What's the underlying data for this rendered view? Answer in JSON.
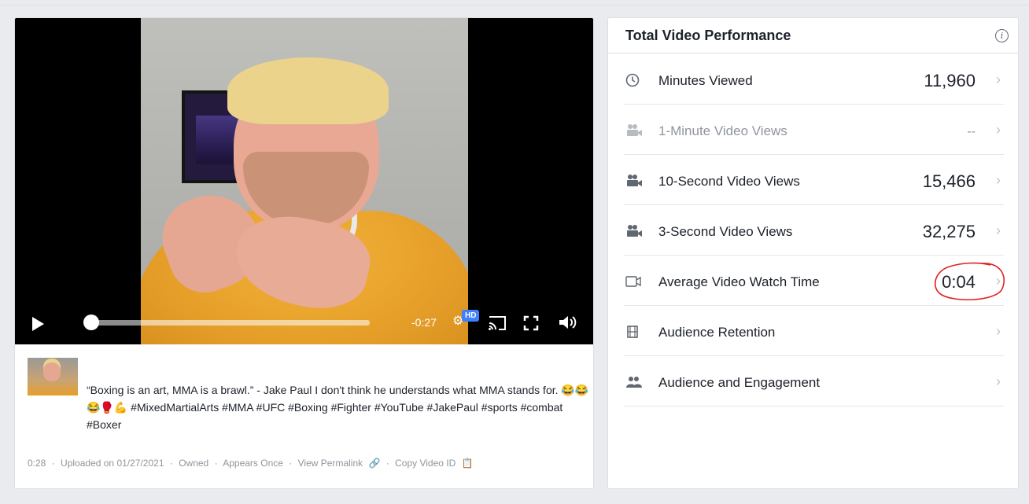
{
  "player": {
    "time_remaining": "-0:27",
    "hd_badge": "HD",
    "progress": 0.03
  },
  "post": {
    "caption": "“Boxing is an art, MMA is a brawl.” - Jake Paul I don't think he understands what MMA stands for. 😂😂😂🥊💪 #MixedMartialArts #MMA #UFC #Boxing #Fighter #YouTube #JakePaul #sports #combat #Boxer",
    "meta": {
      "duration": "0:28",
      "uploaded": "Uploaded on 01/27/2021",
      "owned": "Owned",
      "appears": "Appears Once",
      "permalink": "View Permalink",
      "copy_id": "Copy Video ID",
      "separator": "·"
    }
  },
  "performance": {
    "title": "Total Video Performance",
    "rows": [
      {
        "label": "Minutes Viewed",
        "value": "11,960",
        "icon": "clock-icon"
      },
      {
        "label": "1-Minute Video Views",
        "value": "--",
        "icon": "camera-icon"
      },
      {
        "label": "10-Second Video Views",
        "value": "15,466",
        "icon": "camera-icon"
      },
      {
        "label": "3-Second Video Views",
        "value": "32,275",
        "icon": "camera-icon"
      },
      {
        "label": "Average Video Watch Time",
        "value": "0:04",
        "icon": "video-icon"
      },
      {
        "label": "Audience Retention",
        "value": "",
        "icon": "film-icon"
      },
      {
        "label": "Audience and Engagement",
        "value": "",
        "icon": "people-icon"
      }
    ],
    "chevron": "›"
  },
  "colors": {
    "highlight_circle": "#e02020",
    "hd_badge": "#4080ff"
  }
}
